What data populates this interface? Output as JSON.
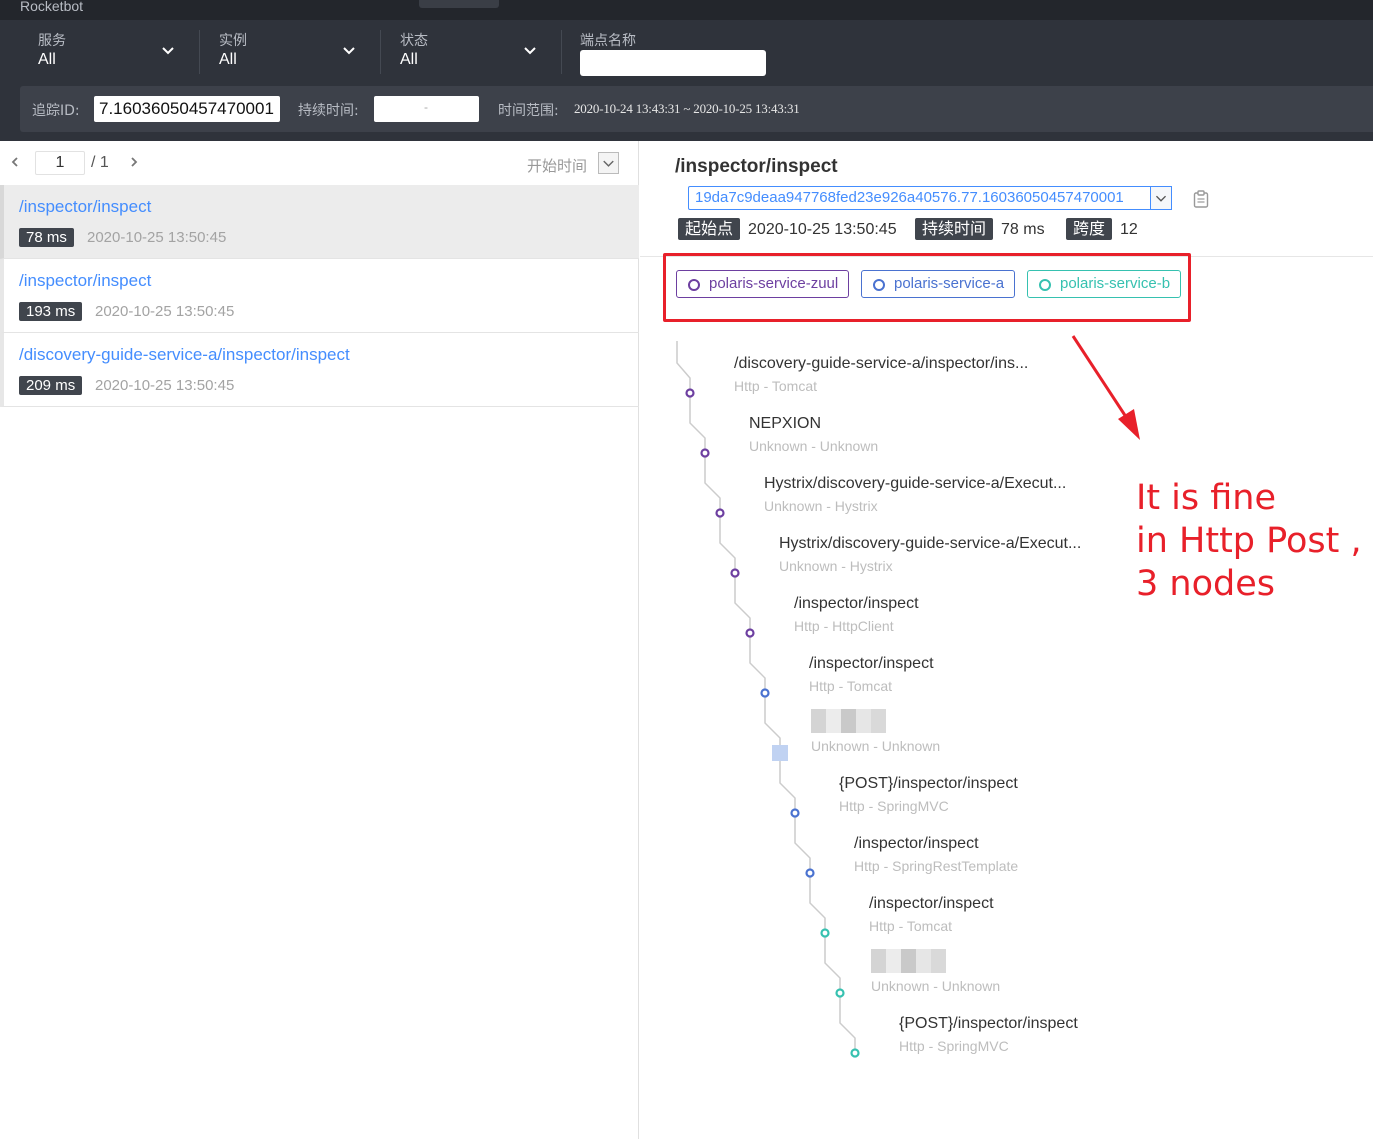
{
  "app": {
    "title": "Rocketbot"
  },
  "filters": {
    "service": {
      "label": "服务",
      "value": "All"
    },
    "instance": {
      "label": "实例",
      "value": "All"
    },
    "status": {
      "label": "状态",
      "value": "All"
    },
    "endpoint": {
      "label": "端点名称",
      "value": ""
    }
  },
  "search": {
    "trace_id_label": "追踪ID:",
    "trace_id_value": "7.16036050457470001",
    "duration_label": "持续时间:",
    "duration_separator": "-",
    "time_range_label": "时间范围:",
    "time_range_value": "2020-10-24 13:43:31 ~ 2020-10-25 13:43:31"
  },
  "pager": {
    "current_page": "1",
    "total_pages": "/ 1",
    "sort_label": "开始时间"
  },
  "traces": [
    {
      "name": "/inspector/inspect",
      "duration": "78 ms",
      "time": "2020-10-25 13:50:45",
      "active": true
    },
    {
      "name": "/inspector/inspect",
      "duration": "193 ms",
      "time": "2020-10-25 13:50:45",
      "active": false
    },
    {
      "name": "/discovery-guide-service-a/inspector/inspect",
      "duration": "209 ms",
      "time": "2020-10-25 13:50:45",
      "active": false
    }
  ],
  "detail": {
    "title": "/inspector/inspect",
    "trace_id": "19da7c9deaa947768fed23e926a40576.77.16036050457470001",
    "start_label": "起始点",
    "start_value": "2020-10-25 13:50:45",
    "duration_label": "持续时间",
    "duration_value": "78 ms",
    "span_label": "跨度",
    "span_value": "12"
  },
  "services": [
    {
      "name": "polaris-service-zuul",
      "color": "#6d3fa0"
    },
    {
      "name": "polaris-service-a",
      "color": "#4a72d0"
    },
    {
      "name": "polaris-service-b",
      "color": "#36c1b0"
    }
  ],
  "spans": [
    {
      "name": "/discovery-guide-service-a/inspector/ins...",
      "sub": "Http - Tomcat",
      "service": 0
    },
    {
      "name": "NEPXION",
      "sub": "Unknown - Unknown",
      "service": 0
    },
    {
      "name": "Hystrix/discovery-guide-service-a/Execut...",
      "sub": "Unknown - Hystrix",
      "service": 0
    },
    {
      "name": "Hystrix/discovery-guide-service-a/Execut...",
      "sub": "Unknown - Hystrix",
      "service": 0
    },
    {
      "name": "/inspector/inspect",
      "sub": "Http - HttpClient",
      "service": 0
    },
    {
      "name": "/inspector/inspect",
      "sub": "Http - Tomcat",
      "service": 1
    },
    {
      "name": "",
      "sub": "Unknown - Unknown",
      "service": 1,
      "redacted": true
    },
    {
      "name": "{POST}/inspector/inspect",
      "sub": "Http - SpringMVC",
      "service": 1
    },
    {
      "name": "/inspector/inspect",
      "sub": "Http - SpringRestTemplate",
      "service": 1
    },
    {
      "name": "/inspector/inspect",
      "sub": "Http - Tomcat",
      "service": 2
    },
    {
      "name": "",
      "sub": "Unknown - Unknown",
      "service": 2,
      "redacted": true
    },
    {
      "name": "{POST}/inspector/inspect",
      "sub": "Http - SpringMVC",
      "service": 2
    }
  ],
  "annotation": {
    "text": "It is fine\nin Http Post ,\n3 nodes",
    "color": "#e8202a"
  }
}
